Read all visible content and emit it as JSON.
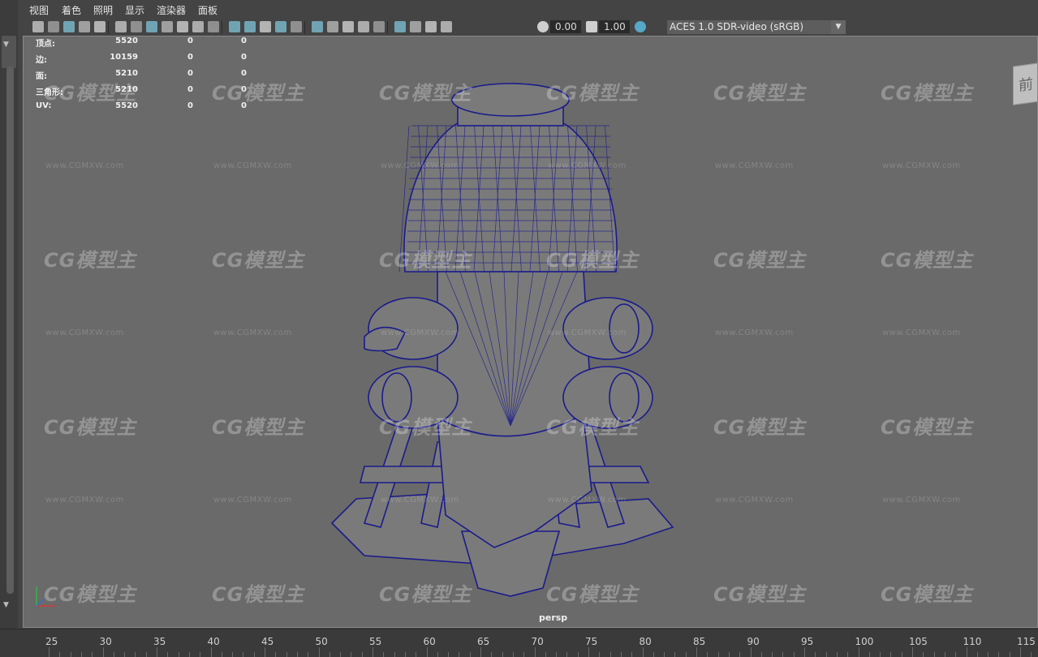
{
  "menu": [
    "视图",
    "着色",
    "照明",
    "显示",
    "渲染器",
    "面板"
  ],
  "toolbar": {
    "exposure": "0.00",
    "gamma": "1.00",
    "colorspace": "ACES 1.0 SDR-video (sRGB)",
    "icons": [
      "camera-icon",
      "camera-attr-icon",
      "bookmark-icon",
      "image-plane-icon",
      "grease-pencil-icon",
      "grid-icon",
      "film-gate-icon",
      "resolution-gate-icon",
      "gate-mask-icon",
      "field-chart-icon",
      "safe-action-icon",
      "safe-title-icon",
      "wireframe-icon",
      "smooth-shade-icon",
      "default-material-icon",
      "wireframe-on-shaded-icon",
      "textured-icon",
      "lights-icon",
      "shadows-icon",
      "xray-icon",
      "xray-joints-icon",
      "isolate-select-icon",
      "ambient-occlusion-icon",
      "motion-blur-icon",
      "anti-alias-icon",
      "dof-icon",
      "exposure-icon",
      "gamma-icon",
      "colormanage-icon"
    ]
  },
  "stats": [
    {
      "label": "顶点:",
      "v1": "5520",
      "v2": "0",
      "v3": "0"
    },
    {
      "label": "边:",
      "v1": "10159",
      "v2": "0",
      "v3": "0"
    },
    {
      "label": "面:",
      "v1": "5210",
      "v2": "0",
      "v3": "0"
    },
    {
      "label": "三角形:",
      "v1": "5210",
      "v2": "0",
      "v3": "0"
    },
    {
      "label": "UV:",
      "v1": "5520",
      "v2": "0",
      "v3": "0"
    }
  ],
  "viewport": {
    "camera_label": "persp",
    "view_cube_face": "前",
    "watermark_logo": "CG模型主",
    "watermark_url": "www.CGMXW.com"
  },
  "colors": {
    "wire": "#1b1b8c",
    "model_fill": "#7a7a7a",
    "viewport_bg": "#6a6a6a"
  },
  "timeline": {
    "ticks": [
      "25",
      "30",
      "35",
      "40",
      "45",
      "50",
      "55",
      "60",
      "65",
      "70",
      "75",
      "80",
      "85",
      "90",
      "95",
      "100",
      "105",
      "110",
      "115"
    ]
  }
}
